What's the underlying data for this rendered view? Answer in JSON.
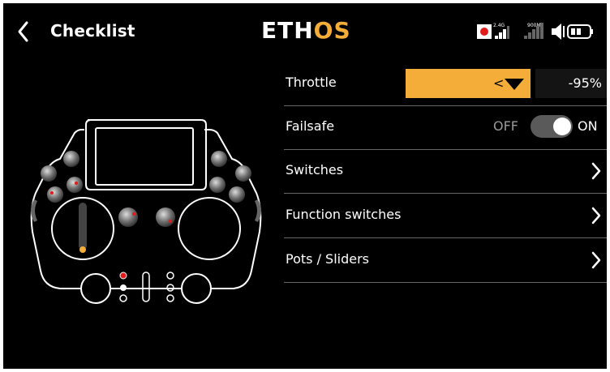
{
  "header": {
    "title": "Checklist",
    "logo_left": "ETH",
    "logo_right": "OS",
    "status": {
      "band_24": "2.4G",
      "band_900": "900M"
    }
  },
  "rows": [
    {
      "label": "Throttle",
      "select_prefix": "<",
      "value": "-95%"
    },
    {
      "label": "Failsafe",
      "off_label": "OFF",
      "on_label": "ON",
      "state": "on"
    },
    {
      "label": "Switches"
    },
    {
      "label": "Function switches"
    },
    {
      "label": "Pots / Sliders"
    }
  ],
  "colors": {
    "accent": "#f5ad3a",
    "background": "#000000",
    "text": "#ffffff",
    "marker_red": "#e21b1b"
  }
}
